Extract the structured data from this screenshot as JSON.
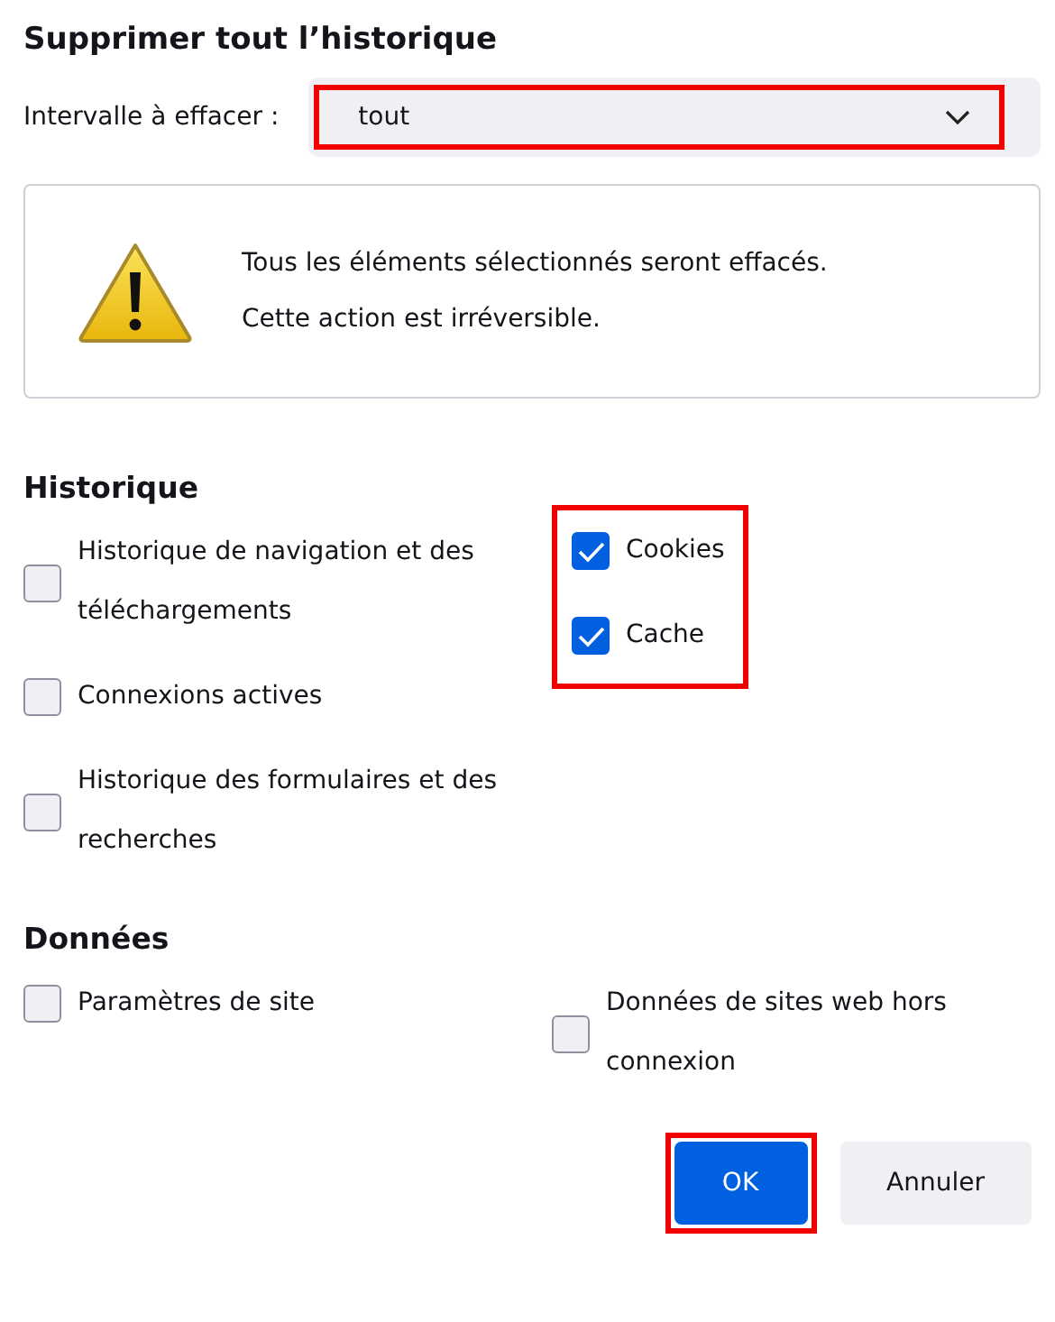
{
  "dialog": {
    "title": "Supprimer tout l’historique"
  },
  "range": {
    "label": "Intervalle à effacer :",
    "value": "tout",
    "highlighted": true
  },
  "warning": {
    "lines": [
      "Tous les éléments sélectionnés seront effacés.",
      "Cette action est irréversible."
    ]
  },
  "history": {
    "heading": "Historique",
    "columns": [
      {
        "highlighted": false,
        "items": [
          {
            "label": "Historique de navigation et des téléchargements",
            "checked": false
          },
          {
            "label": "Connexions actives",
            "checked": false
          },
          {
            "label": "Historique des formulaires et des recherches",
            "checked": false
          }
        ]
      },
      {
        "highlighted": true,
        "items": [
          {
            "label": "Cookies",
            "checked": true
          },
          {
            "label": "Cache",
            "checked": true
          }
        ]
      }
    ]
  },
  "data": {
    "heading": "Données",
    "columns": [
      {
        "highlighted": false,
        "items": [
          {
            "label": "Paramètres de site",
            "checked": false
          }
        ]
      },
      {
        "highlighted": false,
        "items": [
          {
            "label": "Données de sites web hors connexion",
            "checked": false
          }
        ]
      }
    ]
  },
  "buttons": [
    {
      "label": "OK",
      "kind": "primary",
      "highlighted": true
    },
    {
      "label": "Annuler",
      "kind": "secondary",
      "highlighted": false
    }
  ]
}
